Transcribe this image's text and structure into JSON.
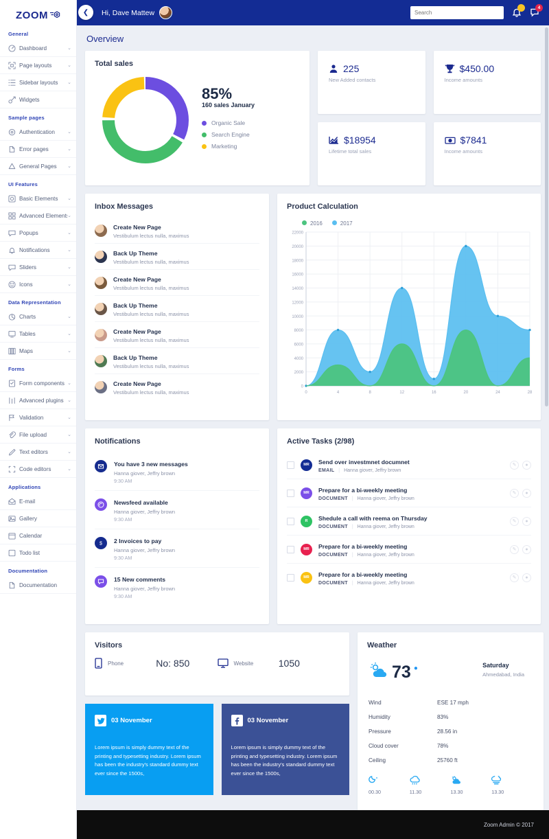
{
  "brand": {
    "name": "ZOOM",
    "icon": "cube-icon"
  },
  "topbar": {
    "collapse_icon": "chevron-left-icon",
    "greeting": "Hi, Dave Mattew",
    "avatar": "user-avatar",
    "search_placeholder": "Search",
    "bell_icon": "bell-icon",
    "bell_badge": "",
    "bell_badge_color": "#f7c325",
    "message_icon": "message-icon",
    "message_badge": "4",
    "message_badge_color": "#e0254c"
  },
  "page": {
    "title": "Overview"
  },
  "sidebar": {
    "sections": [
      {
        "label": "General",
        "items": [
          {
            "label": "Dashboard",
            "icon": "dashboard-icon",
            "caret": true
          },
          {
            "label": "Page layouts",
            "icon": "layout-icon",
            "caret": true
          },
          {
            "label": "Sidebar layouts",
            "icon": "sidebar-icon",
            "caret": true
          },
          {
            "label": "Widgets",
            "icon": "widget-icon",
            "caret": false
          }
        ]
      },
      {
        "label": "Sample pages",
        "items": [
          {
            "label": "Authentication",
            "icon": "key-icon",
            "caret": true
          },
          {
            "label": "Error pages",
            "icon": "error-icon",
            "caret": true
          },
          {
            "label": "General Pages",
            "icon": "pages-icon",
            "caret": true
          }
        ]
      },
      {
        "label": "UI Features",
        "items": [
          {
            "label": "Basic Elements",
            "icon": "basic-elements-icon",
            "caret": true
          },
          {
            "label": "Advanced Elements",
            "icon": "advanced-elements-icon",
            "caret": true
          },
          {
            "label": "Popups",
            "icon": "popup-icon",
            "caret": true
          },
          {
            "label": "Notifications",
            "icon": "notification-bell-icon",
            "caret": true
          },
          {
            "label": "Sliders",
            "icon": "slider-icon",
            "caret": true
          },
          {
            "label": "Icons",
            "icon": "smiley-icon",
            "caret": true
          }
        ]
      },
      {
        "label": "Data Representation",
        "items": [
          {
            "label": "Charts",
            "icon": "chart-icon",
            "caret": true
          },
          {
            "label": "Tables",
            "icon": "table-icon",
            "caret": true
          },
          {
            "label": "Maps",
            "icon": "map-icon",
            "caret": true
          }
        ]
      },
      {
        "label": "Forms",
        "items": [
          {
            "label": "Form components",
            "icon": "form-icon",
            "caret": true
          },
          {
            "label": "Advanced plugins",
            "icon": "plugins-icon",
            "caret": true
          },
          {
            "label": "Validation",
            "icon": "validation-icon",
            "caret": true
          },
          {
            "label": "File upload",
            "icon": "upload-icon",
            "caret": true
          },
          {
            "label": "Text editors",
            "icon": "pencil-icon",
            "caret": true
          },
          {
            "label": "Code editors",
            "icon": "code-icon",
            "caret": true
          }
        ]
      },
      {
        "label": "Applications",
        "items": [
          {
            "label": "E-mail",
            "icon": "mail-icon",
            "caret": false
          },
          {
            "label": "Gallery",
            "icon": "gallery-icon",
            "caret": false
          },
          {
            "label": "Calendar",
            "icon": "calendar-icon",
            "caret": false
          },
          {
            "label": "Todo list",
            "icon": "todo-icon",
            "caret": false
          }
        ]
      },
      {
        "label": "Documentation",
        "items": [
          {
            "label": "Documentation",
            "icon": "document-icon",
            "caret": false
          }
        ]
      }
    ]
  },
  "total_sales": {
    "title": "Total sales",
    "percent": "85%",
    "subtitle": "160 sales January",
    "legend": [
      {
        "label": "Organic Sale",
        "color": "#6c4ee0"
      },
      {
        "label": "Search Engine",
        "color": "#43bd6a"
      },
      {
        "label": "Marketing",
        "color": "#fac213"
      }
    ]
  },
  "tiles": [
    {
      "icon": "person-icon",
      "value": "225",
      "label": "New Added contacts"
    },
    {
      "icon": "trophy-icon",
      "value": "$450.00",
      "label": "Income amounts"
    },
    {
      "icon": "growth-chart-icon",
      "value": "$18954",
      "label": "Lifetime total sales"
    },
    {
      "icon": "money-icon",
      "value": "$7841",
      "label": "Income amounts"
    }
  ],
  "inbox": {
    "title": "Inbox Messages",
    "items": [
      {
        "title": "Create New Page",
        "subtitle": "Vestibulum lectus nulla, maximus",
        "avatar_color": "#8d6b4f"
      },
      {
        "title": "Back Up Theme",
        "subtitle": "Vestibulum lectus nulla, maximus",
        "avatar_color": "#2c3550"
      },
      {
        "title": "Create New Page",
        "subtitle": "Vestibulum lectus nulla, maximus",
        "avatar_color": "#7a5a3c"
      },
      {
        "title": "Back Up Theme",
        "subtitle": "Vestibulum lectus nulla, maximus",
        "avatar_color": "#6a5648"
      },
      {
        "title": "Create New Page",
        "subtitle": "Vestibulum lectus nulla, maximus",
        "avatar_color": "#c99a8a"
      },
      {
        "title": "Back Up Theme",
        "subtitle": "Vestibulum lectus nulla, maximus",
        "avatar_color": "#4f7a52"
      },
      {
        "title": "Create New Page",
        "subtitle": "Vestibulum lectus nulla, maximus",
        "avatar_color": "#6b6f84"
      }
    ]
  },
  "chart_data": {
    "type": "area",
    "title": "Product Calculation",
    "xlabel": "",
    "ylabel": "",
    "x": [
      0,
      4,
      8,
      12,
      16,
      20,
      24,
      28
    ],
    "xticks": [
      0,
      4,
      8,
      12,
      16,
      20,
      24,
      28
    ],
    "yticks": [
      0,
      2000,
      4000,
      6000,
      8000,
      10000,
      12000,
      14000,
      16000,
      18000,
      20000,
      22000
    ],
    "ylim": [
      0,
      22000
    ],
    "xlim": [
      0,
      28
    ],
    "grid": true,
    "legend_position": "top-left",
    "series": [
      {
        "name": "2017",
        "color": "#59bef0",
        "values": [
          0,
          8000,
          2000,
          14000,
          1000,
          20000,
          10000,
          8000
        ]
      },
      {
        "name": "2016",
        "color": "#4cc47f",
        "values": [
          0,
          3000,
          0,
          6000,
          0,
          8000,
          0,
          4000
        ]
      }
    ]
  },
  "notifications": {
    "title": "Notifications",
    "items": [
      {
        "title": "You have 3 new messages",
        "subtitle": "Hanna giover, Jeffry brown",
        "time": "9:30 AM",
        "icon": "envelope-icon",
        "color": "#152b8e"
      },
      {
        "title": "Newsfeed available",
        "subtitle": "Hanna giover, Jeffry brown",
        "time": "9:30 AM",
        "icon": "rss-icon",
        "color": "#7b4fe8"
      },
      {
        "title": "2 Invoices to pay",
        "subtitle": "Hanna giover, Jeffry brown",
        "time": "9:30 AM",
        "icon": "dollar-icon",
        "color": "#152b8e"
      },
      {
        "title": "15 New comments",
        "subtitle": "Hanna giover, Jeffry brown",
        "time": "9:30 AM",
        "icon": "comment-icon",
        "color": "#7b4fe8"
      }
    ]
  },
  "tasks": {
    "title": "Active Tasks (2/98)",
    "items": [
      {
        "title": "Send over investmnet documnet",
        "type": "EMAIL",
        "people": "Hanna giover, Jeffry brown",
        "initials": "MR",
        "color": "#132c94"
      },
      {
        "title": "Prepare for a bi-weekly meeting",
        "type": "DOCUMENT",
        "people": "Hanna giover, Jeffry brown",
        "initials": "MR",
        "color": "#7b4fe8"
      },
      {
        "title": "Shedule a call with reema on Thursday",
        "type": "DOCUMENT",
        "people": "Hanna giover, Jeffry brown",
        "initials": "R",
        "color": "#2ec363"
      },
      {
        "title": "Prepare for a bi-weekly meeting",
        "type": "DOCUMENT",
        "people": "Hanna giover, Jeffry brown",
        "initials": "MR",
        "color": "#e8214f"
      },
      {
        "title": "Prepare for a bi-weekly meeting",
        "type": "DOCUMENT",
        "people": "Hanna giover, Jeffry brown",
        "initials": "MR",
        "color": "#fac213"
      }
    ],
    "edit_icon": "pencil-circle-icon",
    "delete_icon": "trash-circle-icon"
  },
  "visitors": {
    "title": "Visitors",
    "phone_label": "Phone",
    "phone_icon": "mobile-icon",
    "phone_value": "No: 850",
    "website_label": "Website",
    "website_icon": "monitor-icon",
    "website_value": "1050"
  },
  "social": [
    {
      "network": "twitter",
      "icon": "twitter-icon",
      "date": "03 November",
      "text": "Lorem ipsum is simply dummy text of the printing and typesetting industry. Lorem ipsum has been the industry's standard dummy text ever since the 1500s,",
      "bg": "#089ef2",
      "fg": "#089ef2"
    },
    {
      "network": "facebook",
      "icon": "facebook-icon",
      "date": "03 November",
      "text": "Lorem ipsum is simply dummy text of the printing and typesetting industry. Lorem ipsum has been the industry's standard dummy text ever since the 1500s,",
      "bg": "#3b5196",
      "fg": "#3b5196"
    }
  ],
  "weather": {
    "title": "Weather",
    "icon": "sun-cloud-icon",
    "temp": "73",
    "degree": "o",
    "day": "Saturday",
    "location": "Ahmedabad, India",
    "rows": [
      {
        "key": "Wind",
        "value": "ESE 17 mph"
      },
      {
        "key": "Humidity",
        "value": "83%"
      },
      {
        "key": "Pressure",
        "value": "28.56 in"
      },
      {
        "key": "Cloud cover",
        "value": "78%"
      },
      {
        "key": "Ceiling",
        "value": "25760 ft"
      }
    ],
    "forecast": [
      {
        "icon": "moon-cloud-icon",
        "time": "00.30"
      },
      {
        "icon": "rain-icon",
        "time": "11.30"
      },
      {
        "icon": "sun-cloud-icon",
        "time": "13.30"
      },
      {
        "icon": "fog-icon",
        "time": "13.30"
      }
    ]
  },
  "footer": {
    "text": "Zoom Admin © 2017"
  }
}
